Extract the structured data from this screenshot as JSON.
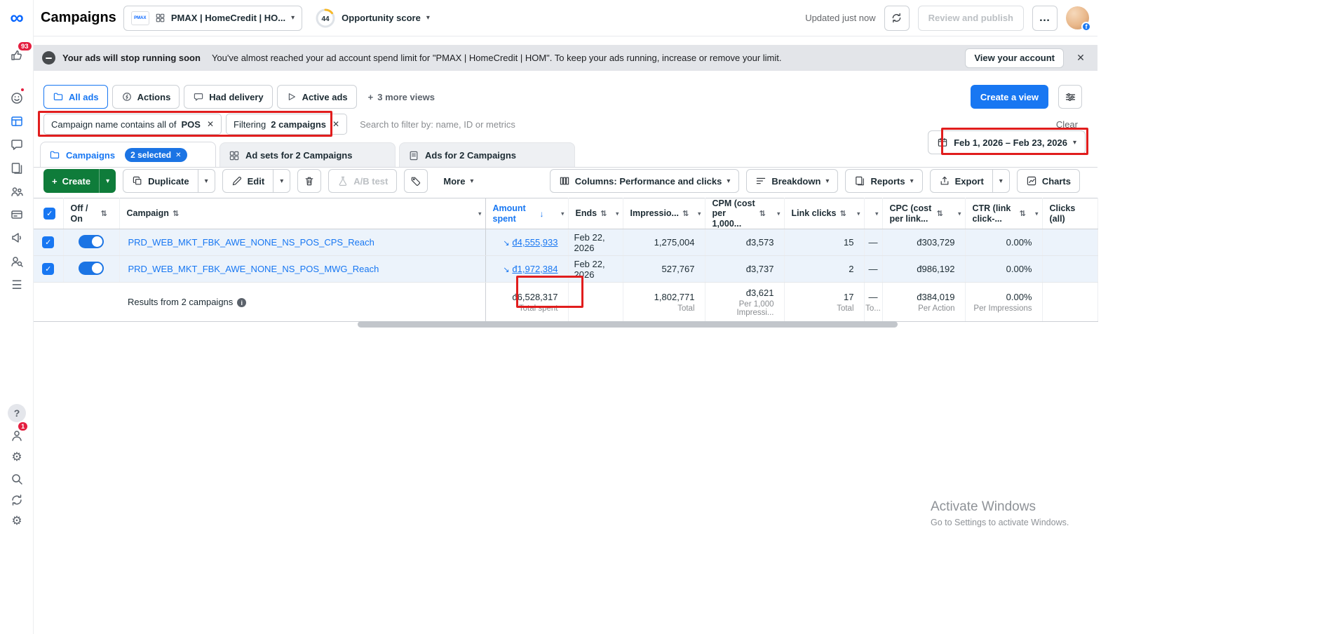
{
  "icons": {
    "caret": "▾",
    "sort": "⇅",
    "sort_down": "↓",
    "trend": "↘",
    "close": "✕",
    "ellipsis": "…",
    "plus": "+",
    "help": "?",
    "menu": "☰",
    "gear": "⚙",
    "infinity": "∞",
    "info": "i",
    "check": "✓",
    "dash": "—"
  },
  "sidebar": {
    "notif_badge": "93",
    "updates_badge": "1"
  },
  "header": {
    "title": "Campaigns",
    "account_logo": "PMAX",
    "account_name": "PMAX | HomeCredit | HO...",
    "opportunity_score": "44",
    "opportunity_label": "Opportunity score",
    "updated": "Updated just now",
    "review_publish": "Review and publish",
    "avatar_badge": "f"
  },
  "banner": {
    "title": "Your ads will stop running soon",
    "message": "You've almost reached your ad account spend limit for \"PMAX | HomeCredit | HOM\". To keep your ads running, increase or remove your limit.",
    "action": "View your account"
  },
  "views": {
    "tabs": [
      {
        "label": "All ads"
      },
      {
        "label": "Actions"
      },
      {
        "label": "Had delivery"
      },
      {
        "label": "Active ads"
      }
    ],
    "more": "3 more views",
    "create_view": "Create a view"
  },
  "filters": {
    "chip1_prefix": "Campaign name contains all of",
    "chip1_value": "POS",
    "chip2_prefix": "Filtering",
    "chip2_value": "2 campaigns",
    "search_placeholder": "Search to filter by: name, ID or metrics",
    "clear": "Clear"
  },
  "levels": {
    "campaigns": "Campaigns",
    "campaigns_badge": "2 selected",
    "adsets": "Ad sets for 2 Campaigns",
    "ads": "Ads for 2 Campaigns",
    "date_range": "Feb 1, 2026 – Feb 23, 2026"
  },
  "toolbar": {
    "create": "Create",
    "duplicate": "Duplicate",
    "edit": "Edit",
    "ab_test": "A/B test",
    "more": "More",
    "columns": "Columns: Performance and clicks",
    "breakdown": "Breakdown",
    "reports": "Reports",
    "export": "Export",
    "charts": "Charts"
  },
  "table": {
    "headers": {
      "off_on": "Off / On",
      "campaign": "Campaign",
      "amount_spent": "Amount spent",
      "ends": "Ends",
      "impressions": "Impressio...",
      "cpm": "CPM (cost per 1,000...",
      "link_clicks": "Link clicks",
      "cpc": "CPC (cost per link...",
      "ctr": "CTR (link click-...",
      "clicks_all": "Clicks (all)"
    },
    "rows": [
      {
        "name": "PRD_WEB_MKT_FBK_AWE_NONE_NS_POS_CPS_Reach",
        "amount_spent": "đ4,555,933",
        "ends": "Feb 22, 2026",
        "impressions": "1,275,004",
        "cpm": "đ3,573",
        "link_clicks": "15",
        "col9": "—",
        "cpc": "đ303,729",
        "ctr": "0.00%"
      },
      {
        "name": "PRD_WEB_MKT_FBK_AWE_NONE_NS_POS_MWG_Reach",
        "amount_spent": "đ1,972,384",
        "ends": "Feb 22, 2026",
        "impressions": "527,767",
        "cpm": "đ3,737",
        "link_clicks": "2",
        "col9": "—",
        "cpc": "đ986,192",
        "ctr": "0.00%"
      }
    ],
    "summary": {
      "label": "Results from 2 campaigns",
      "amount": "đ6,528,317",
      "amount_sub": "Total spent",
      "impressions": "1,802,771",
      "impressions_sub": "Total",
      "cpm": "đ3,621",
      "cpm_sub": "Per 1,000 Impressi...",
      "link_clicks": "17",
      "link_clicks_sub": "Total",
      "col9": "—",
      "col9_sub": "To...",
      "cpc": "đ384,019",
      "cpc_sub": "Per Action",
      "ctr": "0.00%",
      "ctr_sub": "Per Impressions"
    }
  },
  "watermark": {
    "line1": "Activate Windows",
    "line2": "Go to Settings to activate Windows."
  }
}
